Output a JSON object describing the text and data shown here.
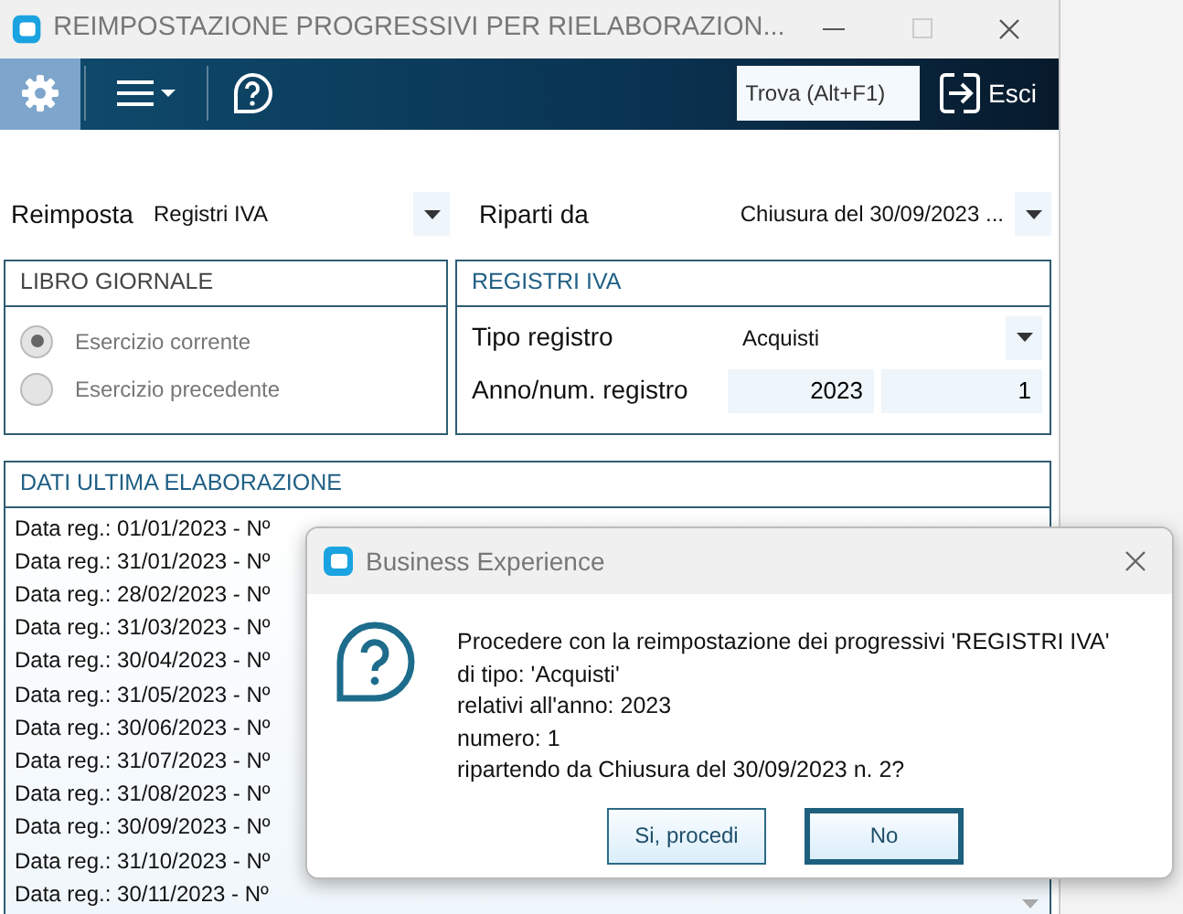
{
  "window": {
    "title": "REIMPOSTAZIONE PROGRESSIVI PER RIELABORAZION...",
    "maximize_disabled": true
  },
  "toolbar": {
    "items": [
      {
        "kind": "settings",
        "selected": true
      },
      {
        "kind": "menu",
        "selected": false
      },
      {
        "kind": "help",
        "selected": false
      }
    ],
    "search": {
      "placeholder": "Trova (Alt+F1)"
    },
    "exit_label": "Esci"
  },
  "form": {
    "reimposta": {
      "label": "Reimposta",
      "value": "Registri IVA"
    },
    "riparti": {
      "label": "Riparti da",
      "value": "Chiusura del 30/09/2023 ..."
    }
  },
  "libro_giornale": {
    "title": "LIBRO GIORNALE",
    "options": [
      {
        "label": "Esercizio corrente",
        "selected": true,
        "disabled": true
      },
      {
        "label": "Esercizio precedente",
        "selected": false,
        "disabled": true
      }
    ]
  },
  "registri_iva": {
    "title": "REGISTRI IVA",
    "tipo_label": "Tipo registro",
    "tipo_value": "Acquisti",
    "anno_label": "Anno/num. registro",
    "anno": "2023",
    "numero": "1"
  },
  "dati": {
    "title": "DATI ULTIMA ELABORAZIONE",
    "rows": [
      "Data reg.: 01/01/2023 - Nº",
      "Data reg.: 31/01/2023 - Nº",
      "Data reg.: 28/02/2023 - Nº",
      "Data reg.: 31/03/2023 - Nº",
      "Data reg.: 30/04/2023 - Nº",
      "Data reg.: 31/05/2023 - Nº",
      "Data reg.: 30/06/2023 - Nº",
      "Data reg.: 31/07/2023 - Nº",
      "Data reg.: 31/08/2023 - Nº",
      "Data reg.: 30/09/2023 - Nº",
      "Data reg.: 31/10/2023 - Nº",
      "Data reg.: 30/11/2023 - Nº"
    ]
  },
  "dialog": {
    "title": "Business Experience",
    "lines": [
      "Procedere con la reimpostazione dei progressivi 'REGISTRI IVA'",
      "di tipo: 'Acquisti'",
      "relativi all'anno: 2023",
      "numero: 1",
      "ripartendo da Chiusura del 30/09/2023 n. 2?"
    ],
    "buttons": [
      {
        "label": "Si, procedi",
        "default": false
      },
      {
        "label": "No",
        "default": true
      }
    ]
  }
}
